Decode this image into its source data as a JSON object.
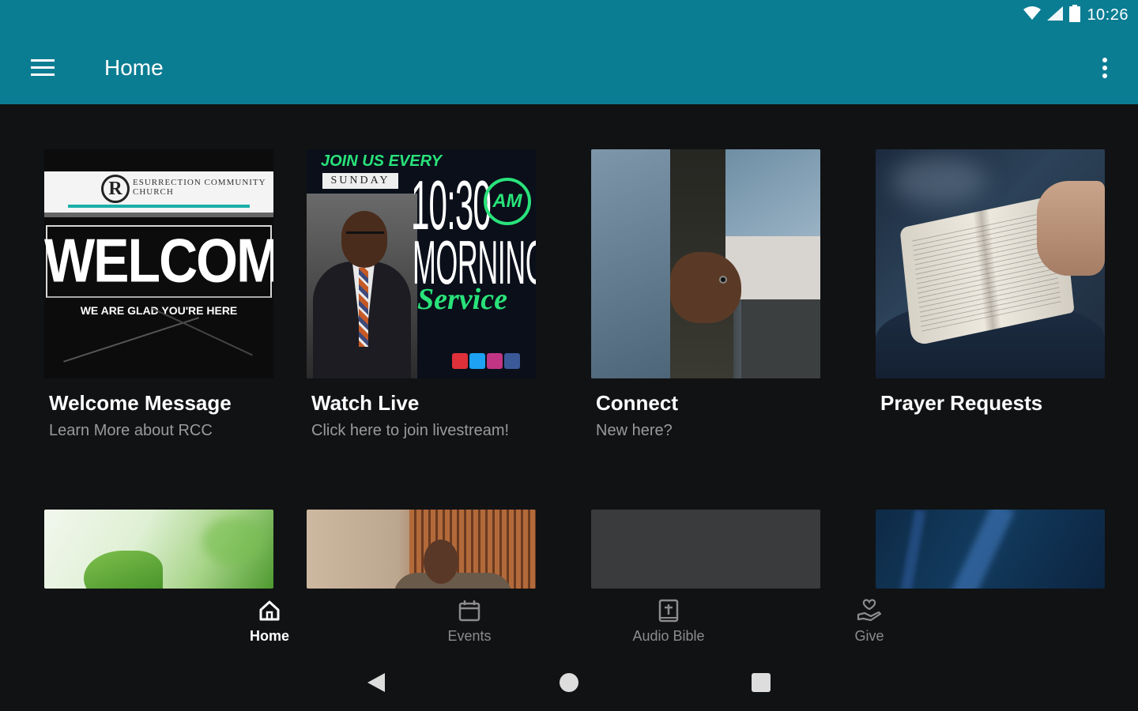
{
  "status_bar": {
    "time": "10:26",
    "icons": [
      "wifi-icon",
      "signal-icon",
      "battery-icon"
    ]
  },
  "app_bar": {
    "title": "Home",
    "menu_icon": "hamburger-menu-icon",
    "more_icon": "more-vert-icon"
  },
  "colors": {
    "primary": "#0b7d93",
    "background": "#111214",
    "text_secondary": "#9a9a9a",
    "accent_green": "#29e37a"
  },
  "cards": [
    {
      "title": "Welcome Message",
      "subtitle": "Learn More about RCC",
      "image": {
        "logo_letter": "R",
        "logo_text": "ESURRECTION COMMUNITY CHURCH",
        "headline": "WELCOME",
        "tagline": "WE ARE GLAD YOU'RE HERE"
      }
    },
    {
      "title": "Watch Live",
      "subtitle": "Click here to join livestream!",
      "image": {
        "join": "JOIN US EVERY",
        "day": "SUNDAY",
        "time": "10:30",
        "ampm": "AM",
        "morning": "MORNING",
        "service": "Service"
      }
    },
    {
      "title": "Connect",
      "subtitle": "New here?"
    },
    {
      "title": "Prayer Requests",
      "subtitle": ""
    }
  ],
  "bottom_nav": [
    {
      "label": "Home",
      "icon": "home-icon",
      "active": true
    },
    {
      "label": "Events",
      "icon": "calendar-icon",
      "active": false
    },
    {
      "label": "Audio Bible",
      "icon": "bible-icon",
      "active": false
    },
    {
      "label": "Give",
      "icon": "give-hand-icon",
      "active": false
    }
  ],
  "system_nav": [
    "back-icon",
    "home-circle-icon",
    "recents-icon"
  ]
}
